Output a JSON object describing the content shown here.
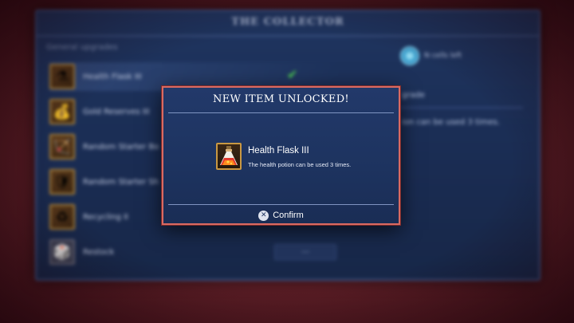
{
  "background": {
    "panel_title": "THE COLLECTOR",
    "section_label": "General upgrades",
    "upgrades": [
      {
        "name": "Health Flask III",
        "icon": "potion-icon",
        "glyph": "⚗",
        "purchased": true
      },
      {
        "name": "Gold Reserves III",
        "icon": "gold-icon",
        "glyph": "💰",
        "purchased": false
      },
      {
        "name": "Random Starter Bo",
        "icon": "bow-icon",
        "glyph": "🏹",
        "purchased": false
      },
      {
        "name": "Random Starter Sh",
        "icon": "shield-icon",
        "glyph": "🛡",
        "purchased": false
      },
      {
        "name": "Recycling II",
        "icon": "recycle-icon",
        "glyph": "♻",
        "purchased": false
      },
      {
        "name": "Restock",
        "icon": "dice-icon",
        "glyph": "🎲",
        "purchased": false,
        "cost": "---"
      }
    ],
    "cells_left": "N cells left",
    "right_heading": "grade",
    "right_desc": "ion can be used 3 times."
  },
  "dialog": {
    "title": "NEW ITEM UNLOCKED!",
    "item_name": "Health Flask III",
    "item_description": "The health potion can be used 3 times.",
    "confirm_button_symbol": "✕",
    "confirm_label": "Confirm",
    "border_color": "#d96a62"
  }
}
